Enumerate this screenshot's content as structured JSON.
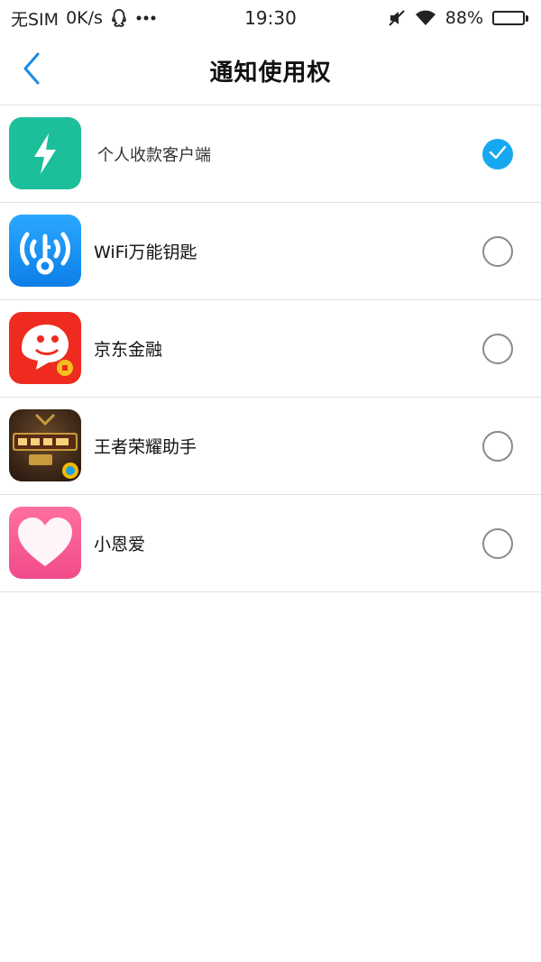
{
  "status_bar": {
    "carrier": "无SIM",
    "speed": "0K/s",
    "time": "19:30",
    "battery": "88%",
    "battery_level": 0.88,
    "icons": [
      "qq-icon",
      "more-dots-icon",
      "mute-icon",
      "wifi-icon",
      "battery-icon"
    ]
  },
  "nav": {
    "back_icon": "chevron-left-icon",
    "title": "通知使用权"
  },
  "apps": [
    {
      "name": "个人收款客户端",
      "icon": "lightning-icon",
      "checked": true
    },
    {
      "name": "WiFi万能钥匙",
      "icon": "wifi-key-icon",
      "checked": false
    },
    {
      "name": "京东金融",
      "icon": "jd-finance-icon",
      "checked": false
    },
    {
      "name": "王者荣耀助手",
      "icon": "honor-of-kings-icon",
      "checked": false
    },
    {
      "name": "小恩爱",
      "icon": "heart-icon",
      "checked": false
    }
  ],
  "colors": {
    "accent": "#16a8f0",
    "back_arrow": "#1a8be6",
    "divider": "#e2e2e2"
  }
}
